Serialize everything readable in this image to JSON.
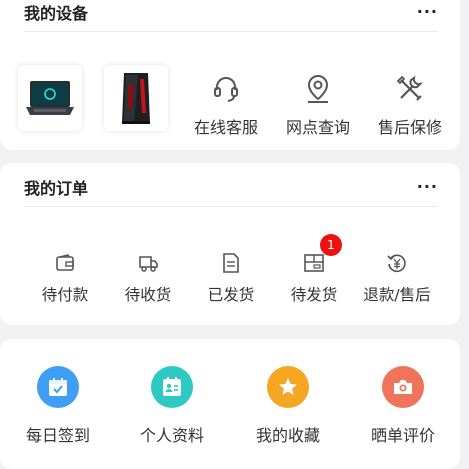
{
  "devices": {
    "title": "我的设备",
    "more": "...",
    "products": [
      {
        "name": "laptop-thumbnail"
      },
      {
        "name": "desktop-thumbnail"
      }
    ],
    "services": [
      {
        "label": "在线客服",
        "icon": "headset-icon"
      },
      {
        "label": "网点查询",
        "icon": "location-pin-icon"
      },
      {
        "label": "售后保修",
        "icon": "repair-tools-icon"
      }
    ]
  },
  "orders": {
    "title": "我的订单",
    "more": "...",
    "items": [
      {
        "label": "待付款",
        "icon": "wallet-icon"
      },
      {
        "label": "待收货",
        "icon": "delivery-truck-icon"
      },
      {
        "label": "已发货",
        "icon": "document-icon"
      },
      {
        "label": "待发货",
        "icon": "package-icon",
        "badge": "1"
      },
      {
        "label": "退款/售后",
        "icon": "refund-yen-icon"
      }
    ]
  },
  "tools": {
    "items": [
      {
        "label": "每日签到",
        "icon": "calendar-check-icon",
        "color": "#3e9ff5"
      },
      {
        "label": "个人资料",
        "icon": "id-card-icon",
        "color": "#2fc9c4"
      },
      {
        "label": "我的收藏",
        "icon": "star-icon",
        "color": "#f5a623"
      },
      {
        "label": "晒单评价",
        "icon": "camera-icon",
        "color": "#f0745a"
      }
    ]
  }
}
